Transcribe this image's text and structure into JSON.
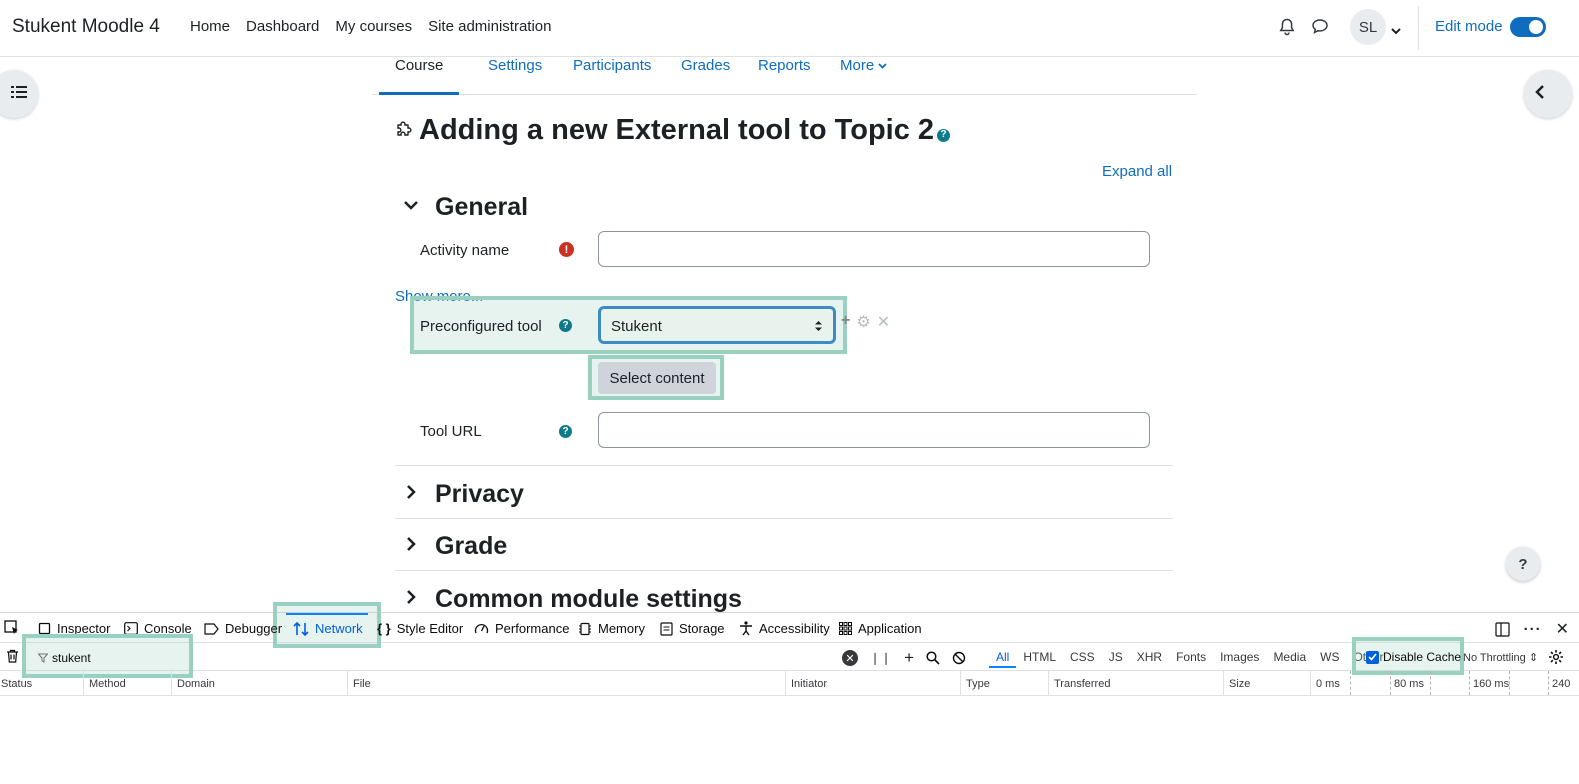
{
  "navbar": {
    "brand": "Stukent Moodle 4",
    "links": [
      "Home",
      "Dashboard",
      "My courses",
      "Site administration"
    ],
    "avatar_initials": "SL",
    "edit_mode_label": "Edit mode"
  },
  "secondary_nav": {
    "tabs": [
      "Course",
      "Settings",
      "Participants",
      "Grades",
      "Reports",
      "More"
    ],
    "active": "Course"
  },
  "page": {
    "title": "Adding a new External tool to Topic 2",
    "expand_all": "Expand all"
  },
  "form": {
    "general_header": "General",
    "activity_name_label": "Activity name",
    "activity_name_value": "",
    "show_more": "Show more...",
    "preconfigured_tool_label": "Preconfigured tool",
    "preconfigured_tool_value": "Stukent",
    "select_content_button": "Select content",
    "tool_url_label": "Tool URL",
    "tool_url_value": "",
    "sections": [
      "Privacy",
      "Grade",
      "Common module settings"
    ]
  },
  "help_button": "?",
  "devtools": {
    "tabs": [
      "Inspector",
      "Console",
      "Debugger",
      "Network",
      "Style Editor",
      "Performance",
      "Memory",
      "Storage",
      "Accessibility",
      "Application"
    ],
    "active_tab": "Network",
    "filter_value": "stukent",
    "type_filters": [
      "All",
      "HTML",
      "CSS",
      "JS",
      "XHR",
      "Fonts",
      "Images",
      "Media",
      "WS",
      "Other"
    ],
    "active_type": "All",
    "disable_cache_label": "Disable Cache",
    "throttling": "No Throttling",
    "columns": [
      "Status",
      "Method",
      "Domain",
      "File",
      "Initiator",
      "Type",
      "Transferred",
      "Size"
    ],
    "timeline_ticks": [
      "0 ms",
      "80 ms",
      "160 ms",
      "240"
    ]
  },
  "colors": {
    "link": "#0f6cbf",
    "highlight": "#9ad0bf",
    "required": "#ca3120",
    "devtools_active": "#0060df"
  }
}
